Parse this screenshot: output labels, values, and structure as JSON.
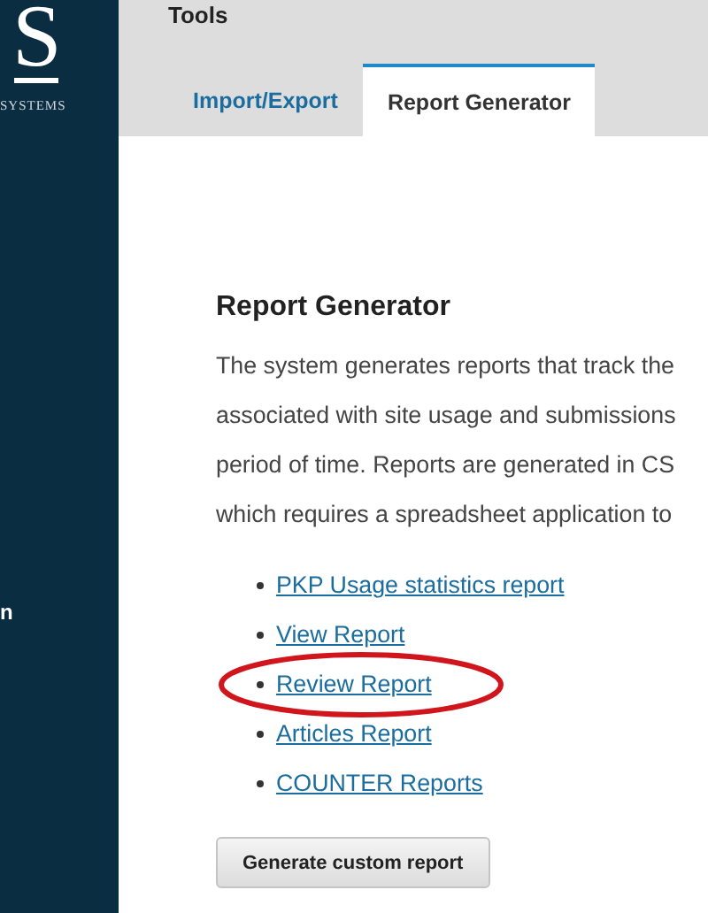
{
  "sidebar": {
    "logo_letter": "S",
    "logo_subtitle": "SYSTEMS",
    "items": [
      "n"
    ]
  },
  "header": {
    "title": "Tools"
  },
  "tabs": [
    {
      "label": "Import/Export",
      "selected": false
    },
    {
      "label": "Report Generator",
      "selected": true
    }
  ],
  "content": {
    "heading": "Report Generator",
    "paragraph_lines": [
      "The system generates reports that track the",
      "associated with site usage and submissions",
      "period of time. Reports are generated in CS",
      "which requires a spreadsheet application to"
    ],
    "links": [
      {
        "label": "PKP Usage statistics report",
        "circled": false
      },
      {
        "label": "View Report",
        "circled": false
      },
      {
        "label": "Review Report",
        "circled": true
      },
      {
        "label": "Articles Report",
        "circled": false
      },
      {
        "label": "COUNTER Reports",
        "circled": false
      }
    ],
    "button": "Generate custom report"
  }
}
